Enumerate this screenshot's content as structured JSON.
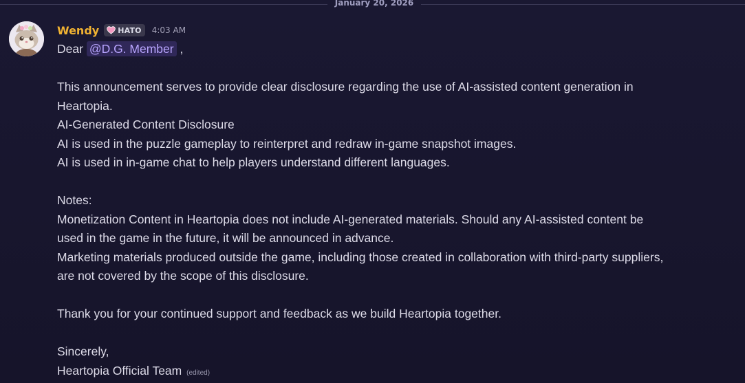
{
  "divider": {
    "date": "January 20, 2026"
  },
  "message": {
    "author": "Wendy",
    "tag": "HATO",
    "time": "4:03 AM",
    "greeting_prefix": "Dear",
    "mention": "@D.G. Member",
    "greeting_suffix": ",",
    "lines": [
      "This announcement serves to provide clear disclosure regarding the use of AI-assisted content generation in",
      "Heartopia.",
      "AI-Generated Content Disclosure",
      "AI is used in the puzzle gameplay to reinterpret and redraw in-game snapshot images.",
      "AI is used in in-game chat to help players understand different languages.",
      "Notes:",
      "Monetization Content in Heartopia does not include AI-generated materials. Should any AI-assisted content be",
      "used in the game in the future, it will be announced in advance.",
      "Marketing materials produced outside the game, including those created in collaboration with third-party suppliers,",
      "are not covered by the scope of this disclosure.",
      "Thank you for your continued support and feedback as we build Heartopia together.",
      "Sincerely,",
      "Heartopia Official Team"
    ],
    "edited_label": "(edited)"
  },
  "colors": {
    "background": "#1a1832",
    "username": "#f0b232",
    "mention": "#b9a6ff",
    "text": "#dddbe8"
  },
  "icons": {
    "tag_icon": "heart-icon",
    "avatar": "cat-avatar"
  }
}
